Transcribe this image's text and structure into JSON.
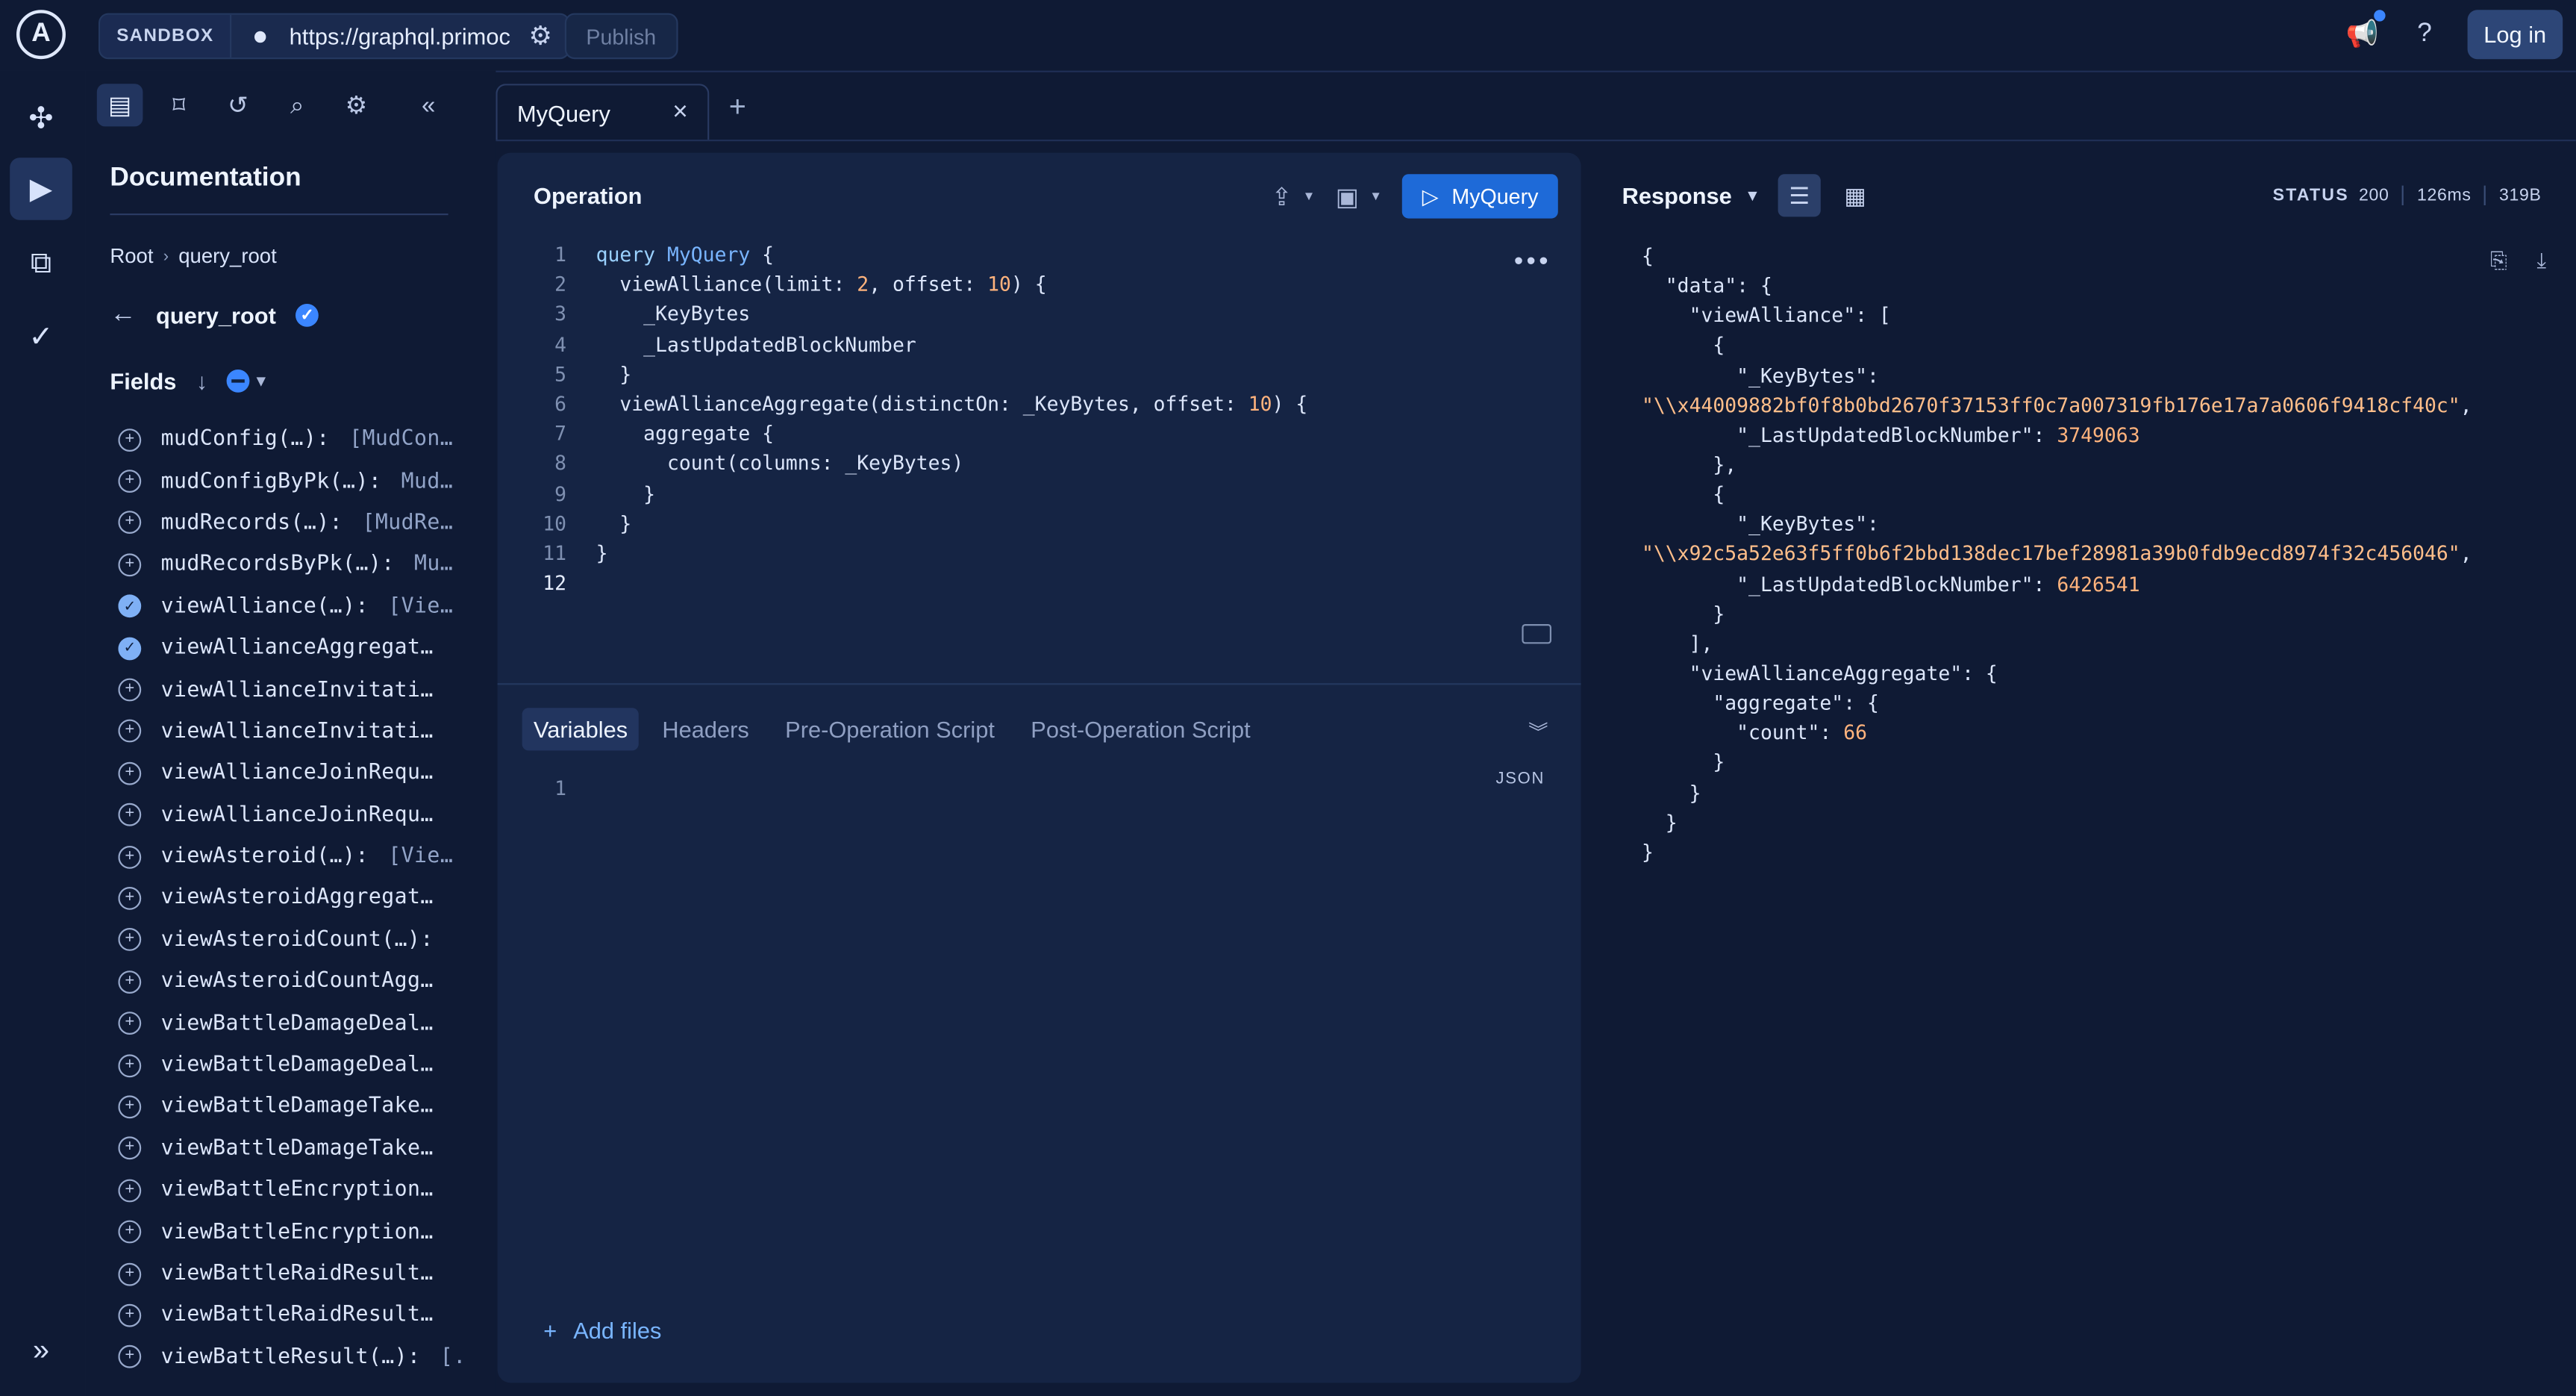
{
  "topbar": {
    "env_badge": "SANDBOX",
    "url": "https://graphql.primoc",
    "publish_label": "Publish",
    "login_label": "Log in"
  },
  "docs": {
    "title": "Documentation",
    "breadcrumb": [
      "Root",
      "query_root"
    ],
    "current": "query_root",
    "fields_label": "Fields",
    "fields": [
      {
        "name": "mudConfig(…):",
        "type": " [MudCon…",
        "selected": false
      },
      {
        "name": "mudConfigByPk(…):",
        "type": " Mud…",
        "selected": false
      },
      {
        "name": "mudRecords(…):",
        "type": " [MudRe…",
        "selected": false
      },
      {
        "name": "mudRecordsByPk(…):",
        "type": " Mu…",
        "selected": false
      },
      {
        "name": "viewAlliance(…):",
        "type": " [Vie…",
        "selected": true
      },
      {
        "name": "viewAllianceAggregat…",
        "type": "",
        "selected": true
      },
      {
        "name": "viewAllianceInvitati…",
        "type": "",
        "selected": false
      },
      {
        "name": "viewAllianceInvitati…",
        "type": "",
        "selected": false
      },
      {
        "name": "viewAllianceJoinRequ…",
        "type": "",
        "selected": false
      },
      {
        "name": "viewAllianceJoinRequ…",
        "type": "",
        "selected": false
      },
      {
        "name": "viewAsteroid(…):",
        "type": " [Vie…",
        "selected": false
      },
      {
        "name": "viewAsteroidAggregat…",
        "type": "",
        "selected": false
      },
      {
        "name": "viewAsteroidCount(…):",
        "type": "",
        "selected": false
      },
      {
        "name": "viewAsteroidCountAgg…",
        "type": "",
        "selected": false
      },
      {
        "name": "viewBattleDamageDeal…",
        "type": "",
        "selected": false
      },
      {
        "name": "viewBattleDamageDeal…",
        "type": "",
        "selected": false
      },
      {
        "name": "viewBattleDamageTake…",
        "type": "",
        "selected": false
      },
      {
        "name": "viewBattleDamageTake…",
        "type": "",
        "selected": false
      },
      {
        "name": "viewBattleEncryption…",
        "type": "",
        "selected": false
      },
      {
        "name": "viewBattleEncryption…",
        "type": "",
        "selected": false
      },
      {
        "name": "viewBattleRaidResult…",
        "type": "",
        "selected": false
      },
      {
        "name": "viewBattleRaidResult…",
        "type": "",
        "selected": false
      },
      {
        "name": "viewBattleResult(…):",
        "type": " [.",
        "selected": false
      }
    ]
  },
  "tab": {
    "label": "MyQuery"
  },
  "operation": {
    "title": "Operation",
    "run_label": "MyQuery",
    "lines": [
      [
        [
          "kw",
          "query "
        ],
        [
          "nm",
          "MyQuery"
        ],
        [
          "pl",
          " {"
        ]
      ],
      [
        [
          "pl",
          "  viewAlliance(limit: "
        ],
        [
          "num",
          "2"
        ],
        [
          "pl",
          ", offset: "
        ],
        [
          "num",
          "10"
        ],
        [
          "pl",
          ") {"
        ]
      ],
      [
        [
          "pl",
          "    _KeyBytes"
        ]
      ],
      [
        [
          "pl",
          "    _LastUpdatedBlockNumber"
        ]
      ],
      [
        [
          "pl",
          "  }"
        ]
      ],
      [
        [
          "pl",
          "  viewAllianceAggregate(distinctOn: _KeyBytes, offset: "
        ],
        [
          "num",
          "10"
        ],
        [
          "pl",
          ") {"
        ]
      ],
      [
        [
          "pl",
          "    aggregate {"
        ]
      ],
      [
        [
          "pl",
          "      count(columns: _KeyBytes)"
        ]
      ],
      [
        [
          "pl",
          "    }"
        ]
      ],
      [
        [
          "pl",
          "  }"
        ]
      ],
      [
        [
          "pl",
          "}"
        ]
      ],
      [
        [
          "pl",
          ""
        ]
      ]
    ],
    "tabs": [
      "Variables",
      "Headers",
      "Pre-Operation Script",
      "Post-Operation Script"
    ],
    "json_label": "JSON",
    "var_line": "1",
    "add_files": "Add files"
  },
  "response": {
    "title": "Response",
    "status_label": "STATUS",
    "status_code": "200",
    "time": "126ms",
    "size": "319B",
    "lines": [
      [
        [
          "rk",
          "{"
        ]
      ],
      [
        [
          "rk",
          "  \"data\": {"
        ]
      ],
      [
        [
          "rk",
          "    \"viewAlliance\": ["
        ]
      ],
      [
        [
          "rk",
          "      {"
        ]
      ],
      [
        [
          "rk",
          "        \"_KeyBytes\":"
        ]
      ],
      [
        [
          "rs",
          "\"\\\\x44009882bf0f8b0bd2670f37153ff0c7a007319fb176e17a7a0606f9418cf40c\""
        ],
        [
          "rk",
          ","
        ]
      ],
      [
        [
          "rk",
          "        \"_LastUpdatedBlockNumber\": "
        ],
        [
          "rn",
          "3749063"
        ]
      ],
      [
        [
          "rk",
          "      },"
        ]
      ],
      [
        [
          "rk",
          "      {"
        ]
      ],
      [
        [
          "rk",
          "        \"_KeyBytes\":"
        ]
      ],
      [
        [
          "rs",
          "\"\\\\x92c5a52e63f5ff0b6f2bbd138dec17bef28981a39b0fdb9ecd8974f32c456046\""
        ],
        [
          "rk",
          ","
        ]
      ],
      [
        [
          "rk",
          "        \"_LastUpdatedBlockNumber\": "
        ],
        [
          "rn",
          "6426541"
        ]
      ],
      [
        [
          "rk",
          "      }"
        ]
      ],
      [
        [
          "rk",
          "    ],"
        ]
      ],
      [
        [
          "rk",
          "    \"viewAllianceAggregate\": {"
        ]
      ],
      [
        [
          "rk",
          "      \"aggregate\": {"
        ]
      ],
      [
        [
          "rk",
          "        \"count\": "
        ],
        [
          "rn",
          "66"
        ]
      ],
      [
        [
          "rk",
          "      }"
        ]
      ],
      [
        [
          "rk",
          "    }"
        ]
      ],
      [
        [
          "rk",
          "  }"
        ]
      ],
      [
        [
          "rk",
          "}"
        ]
      ]
    ]
  }
}
